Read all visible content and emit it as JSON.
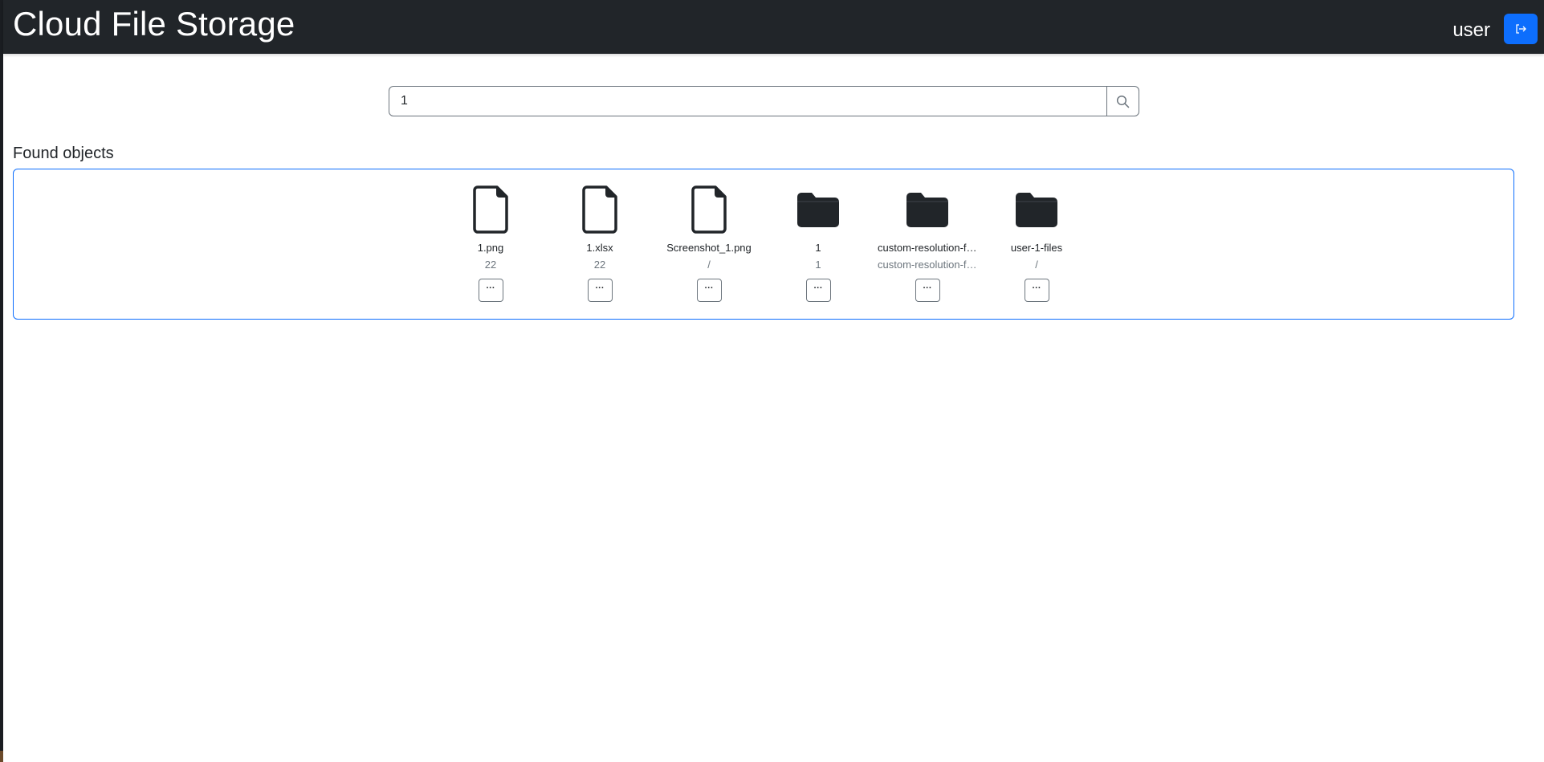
{
  "app": {
    "title": "Cloud File Storage",
    "username": "user",
    "logout_icon": "logout-icon",
    "accent_color": "#0d6efd",
    "navbar_color": "#212529"
  },
  "search": {
    "value": "1",
    "button_icon": "search-icon"
  },
  "results": {
    "heading": "Found objects",
    "menu_label": "···",
    "items": [
      {
        "name": "1.png",
        "path": "22",
        "type": "file",
        "icon": "file-icon"
      },
      {
        "name": "1.xlsx",
        "path": "22",
        "type": "file",
        "icon": "file-icon"
      },
      {
        "name": "Screenshot_1.png",
        "path": "/",
        "type": "file",
        "icon": "file-icon"
      },
      {
        "name": "1",
        "path": "1",
        "type": "folder",
        "icon": "folder-icon"
      },
      {
        "name": "custom-resolution-folder",
        "path": "custom-resolution-folder",
        "type": "folder",
        "icon": "folder-icon"
      },
      {
        "name": "user-1-files",
        "path": "/",
        "type": "folder",
        "icon": "folder-icon"
      }
    ]
  }
}
